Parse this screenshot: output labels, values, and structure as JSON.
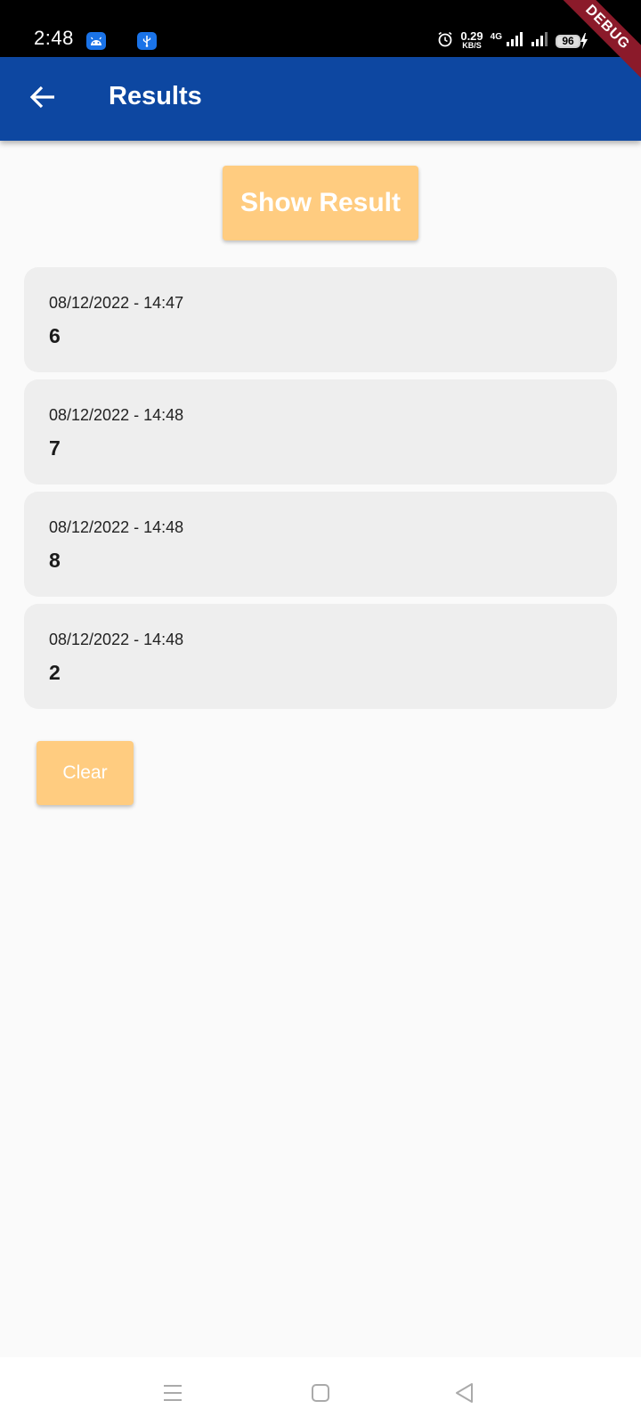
{
  "status_bar": {
    "time": "2:48",
    "net_speed_value": "0.29",
    "net_speed_unit": "KB/S",
    "network_type": "4G",
    "battery_level": "96"
  },
  "debug_banner": "DEBUG",
  "app_bar": {
    "title": "Results"
  },
  "show_result_label": "Show Result",
  "results": [
    {
      "date": "08/12/2022 - 14:47",
      "value": "6"
    },
    {
      "date": "08/12/2022 - 14:48",
      "value": "7"
    },
    {
      "date": "08/12/2022 - 14:48",
      "value": "8"
    },
    {
      "date": "08/12/2022 - 14:48",
      "value": "2"
    }
  ],
  "clear_label": "Clear",
  "colors": {
    "app_bar": "#0d47a1",
    "button": "#ffcc80",
    "card": "#eeeeee",
    "background": "#fafafa",
    "debug_ribbon": "#8b1a2a"
  }
}
